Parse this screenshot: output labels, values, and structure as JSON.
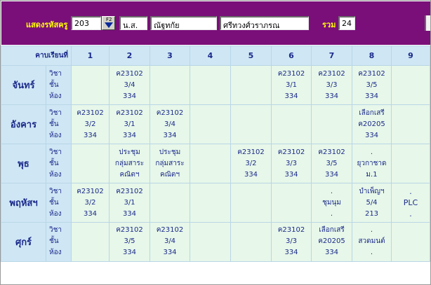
{
  "header": {
    "code_label": "แสดงรหัสครู",
    "code_value": "203",
    "fkey": "F2",
    "title_prefix": "น.ส.",
    "first_name": "ณัฐทกัย",
    "last_name": "ศรีทวงศ์วราภรณ",
    "total_label": "รวม",
    "total_value": "24"
  },
  "periods_label": "คาบเรียนที่",
  "periods": [
    "1",
    "2",
    "3",
    "4",
    "5",
    "6",
    "7",
    "8",
    "9"
  ],
  "row_kinds": [
    "วิชา",
    "ชั้น",
    "ห้อง"
  ],
  "days": [
    {
      "name": "จันทร์",
      "slots": [
        [
          "",
          "",
          ""
        ],
        [
          "ค23102",
          "3/4",
          "334"
        ],
        [
          "",
          "",
          ""
        ],
        [
          "",
          "",
          ""
        ],
        [
          "",
          "",
          ""
        ],
        [
          "ค23102",
          "3/1",
          "334"
        ],
        [
          "ค23102",
          "3/3",
          "334"
        ],
        [
          "ค23102",
          "3/5",
          "334"
        ],
        [
          "",
          "",
          ""
        ]
      ]
    },
    {
      "name": "อังคาร",
      "slots": [
        [
          "ค23102",
          "3/2",
          "334"
        ],
        [
          "ค23102",
          "3/1",
          "334"
        ],
        [
          "ค23102",
          "3/4",
          "334"
        ],
        [
          "",
          "",
          ""
        ],
        [
          "",
          "",
          ""
        ],
        [
          "",
          "",
          ""
        ],
        [
          "",
          "",
          ""
        ],
        [
          "เลือกเสรี",
          "ค20205",
          "334"
        ],
        [
          "",
          "",
          ""
        ]
      ]
    },
    {
      "name": "พุธ",
      "slots": [
        [
          "",
          "",
          ""
        ],
        [
          "ประชุม",
          "กลุ่มสาระ",
          "คณิตฯ"
        ],
        [
          "ประชุม",
          "กลุ่มสาระ",
          "คณิตฯ"
        ],
        [
          "",
          "",
          ""
        ],
        [
          "ค23102",
          "3/2",
          "334"
        ],
        [
          "ค23102",
          "3/3",
          "334"
        ],
        [
          "ค23102",
          "3/5",
          "334"
        ],
        [
          ".",
          "ยุวกาชาด",
          "ม.1"
        ],
        [
          "",
          "",
          ""
        ]
      ]
    },
    {
      "name": "พฤหัสฯ",
      "slots": [
        [
          "ค23102",
          "3/2",
          "334"
        ],
        [
          "ค23102",
          "3/1",
          "334"
        ],
        [
          "",
          "",
          ""
        ],
        [
          "",
          "",
          ""
        ],
        [
          "",
          "",
          ""
        ],
        [
          "",
          "",
          ""
        ],
        [
          ".",
          "ชุมนุม",
          "."
        ],
        [
          "บำเพ็ญฯ",
          "5/4",
          "213"
        ],
        [
          ".",
          "PLC",
          "."
        ]
      ]
    },
    {
      "name": "ศุกร์",
      "slots": [
        [
          "",
          "",
          ""
        ],
        [
          "ค23102",
          "3/5",
          "334"
        ],
        [
          "ค23102",
          "3/4",
          "334"
        ],
        [
          "",
          "",
          ""
        ],
        [
          "",
          "",
          ""
        ],
        [
          "ค23102",
          "3/3",
          "334"
        ],
        [
          "เลือกเสรี",
          "ค20205",
          "334"
        ],
        [
          ".",
          "สวดมนต์",
          "."
        ],
        [
          "",
          "",
          ""
        ]
      ]
    }
  ]
}
